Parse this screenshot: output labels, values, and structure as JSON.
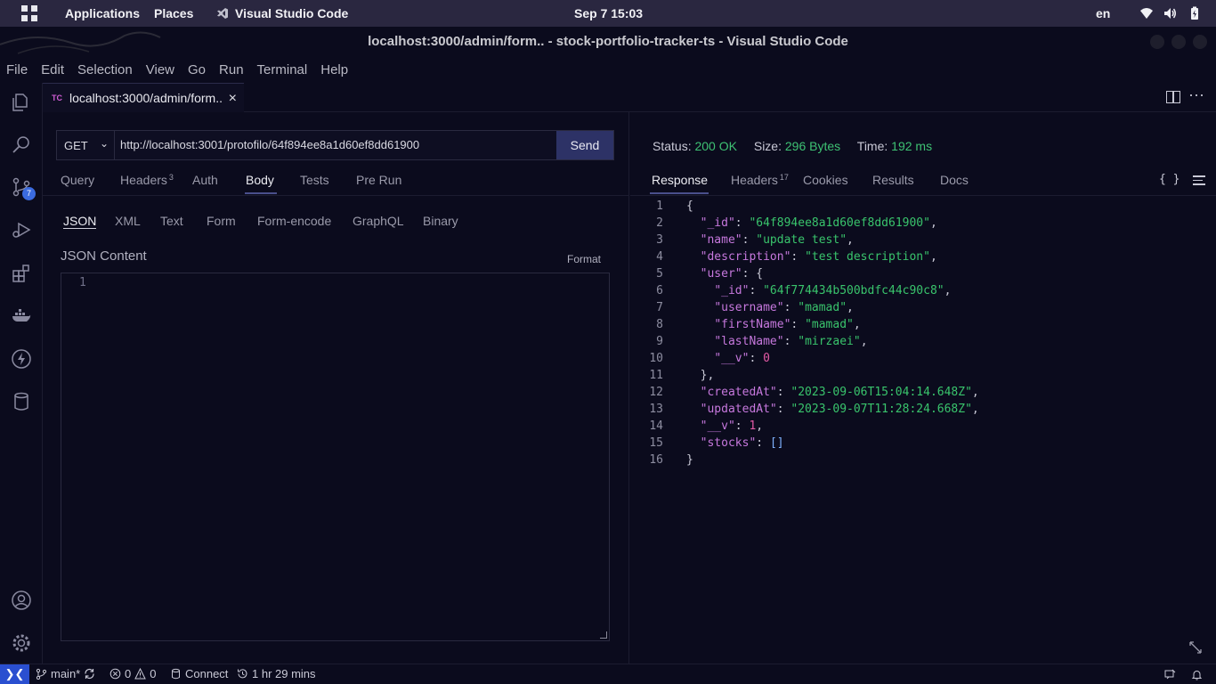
{
  "topbar": {
    "applications": "Applications",
    "places": "Places",
    "app_name": "Visual Studio Code",
    "clock": "Sep 7  15:03",
    "lang": "en"
  },
  "window": {
    "title": "localhost:3000/admin/form.. - stock-portfolio-tracker-ts - Visual Studio Code"
  },
  "menu": [
    "File",
    "Edit",
    "Selection",
    "View",
    "Go",
    "Run",
    "Terminal",
    "Help"
  ],
  "activity_bar": {
    "source_control_badge": "7",
    "icons": [
      "explorer-icon",
      "search-icon",
      "source-control-icon",
      "run-debug-icon",
      "extensions-icon",
      "docker-icon",
      "thunder-client-icon",
      "database-icon",
      "account-icon",
      "settings-gear-icon"
    ]
  },
  "tab": {
    "icon_text": "TC",
    "title": "localhost:3000/admin/form..",
    "close": "×"
  },
  "request": {
    "method": "GET",
    "url": "http://localhost:3001/protofilo/64f894ee8a1d60ef8dd61900",
    "send_label": "Send",
    "tabs": [
      {
        "label": "Query",
        "count": ""
      },
      {
        "label": "Headers",
        "count": "3"
      },
      {
        "label": "Auth",
        "count": ""
      },
      {
        "label": "Body",
        "count": ""
      },
      {
        "label": "Tests",
        "count": ""
      },
      {
        "label": "Pre Run",
        "count": ""
      }
    ],
    "active_tab": "Body",
    "body_tabs": [
      "JSON",
      "XML",
      "Text",
      "Form",
      "Form-encode",
      "GraphQL",
      "Binary"
    ],
    "active_body_tab": "JSON",
    "json_content_label": "JSON Content",
    "format_label": "Format",
    "editor_line": "1"
  },
  "response": {
    "status_label": "Status:",
    "status_value": "200 OK",
    "size_label": "Size:",
    "size_value": "296 Bytes",
    "time_label": "Time:",
    "time_value": "192 ms",
    "tabs": [
      {
        "label": "Response",
        "count": ""
      },
      {
        "label": "Headers",
        "count": "17"
      },
      {
        "label": "Cookies",
        "count": ""
      },
      {
        "label": "Results",
        "count": ""
      },
      {
        "label": "Docs",
        "count": ""
      }
    ],
    "active_tab": "Response",
    "braces_label": "{ }",
    "lines": [
      {
        "n": "1",
        "indent": "",
        "key": "",
        "value": "",
        "value_type": "",
        "tail": "{"
      },
      {
        "n": "2",
        "indent": "  ",
        "key": "\"_id\"",
        "value": "\"64f894ee8a1d60ef8dd61900\"",
        "value_type": "str",
        "tail": ","
      },
      {
        "n": "3",
        "indent": "  ",
        "key": "\"name\"",
        "value": "\"update test\"",
        "value_type": "str",
        "tail": ","
      },
      {
        "n": "4",
        "indent": "  ",
        "key": "\"description\"",
        "value": "\"test description\"",
        "value_type": "str",
        "tail": ","
      },
      {
        "n": "5",
        "indent": "  ",
        "key": "\"user\"",
        "value": "{",
        "value_type": "punc",
        "tail": ""
      },
      {
        "n": "6",
        "indent": "    ",
        "key": "\"_id\"",
        "value": "\"64f774434b500bdfc44c90c8\"",
        "value_type": "str",
        "tail": ","
      },
      {
        "n": "7",
        "indent": "    ",
        "key": "\"username\"",
        "value": "\"mamad\"",
        "value_type": "str",
        "tail": ","
      },
      {
        "n": "8",
        "indent": "    ",
        "key": "\"firstName\"",
        "value": "\"mamad\"",
        "value_type": "str",
        "tail": ","
      },
      {
        "n": "9",
        "indent": "    ",
        "key": "\"lastName\"",
        "value": "\"mirzaei\"",
        "value_type": "str",
        "tail": ","
      },
      {
        "n": "10",
        "indent": "    ",
        "key": "\"__v\"",
        "value": "0",
        "value_type": "numv",
        "tail": ""
      },
      {
        "n": "11",
        "indent": "  ",
        "key": "",
        "value": "",
        "value_type": "",
        "tail": "},"
      },
      {
        "n": "12",
        "indent": "  ",
        "key": "\"createdAt\"",
        "value": "\"2023-09-06T15:04:14.648Z\"",
        "value_type": "str",
        "tail": ","
      },
      {
        "n": "13",
        "indent": "  ",
        "key": "\"updatedAt\"",
        "value": "\"2023-09-07T11:28:24.668Z\"",
        "value_type": "str",
        "tail": ","
      },
      {
        "n": "14",
        "indent": "  ",
        "key": "\"__v\"",
        "value": "1",
        "value_type": "numv",
        "tail": ","
      },
      {
        "n": "15",
        "indent": "  ",
        "key": "\"stocks\"",
        "value": "[]",
        "value_type": "brk",
        "tail": ""
      },
      {
        "n": "16",
        "indent": "",
        "key": "",
        "value": "",
        "value_type": "",
        "tail": "}"
      }
    ]
  },
  "statusbar": {
    "branch": "main*",
    "errors": "0",
    "warnings": "0",
    "connect": "Connect",
    "time_tracked": "1 hr 29 mins"
  },
  "colors": {
    "accent": "#2a4fd0",
    "send_button": "#2d3266",
    "status_ok": "#3ec173",
    "json_key": "#c678dd",
    "json_string": "#39c46c",
    "json_number": "#e45aa6"
  }
}
